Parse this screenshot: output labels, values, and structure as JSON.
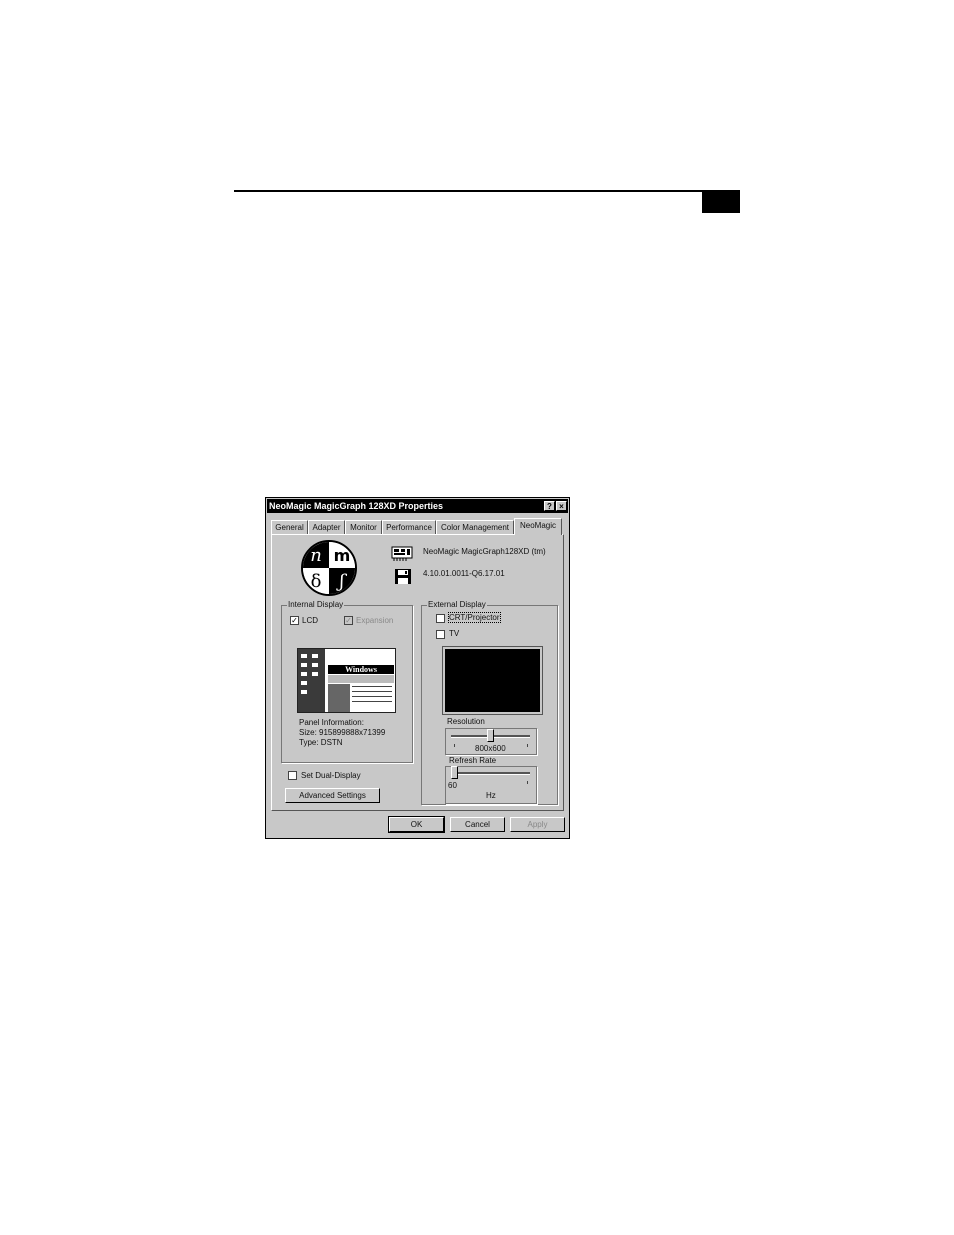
{
  "dialog": {
    "title": "NeoMagic MagicGraph 128XD Properties",
    "help_label": "?",
    "close_label": "×"
  },
  "tabs": [
    {
      "label": "General"
    },
    {
      "label": "Adapter"
    },
    {
      "label": "Monitor"
    },
    {
      "label": "Performance"
    },
    {
      "label": "Color Management"
    },
    {
      "label": "NeoMagic",
      "active": true
    }
  ],
  "logo": {
    "tl": "n",
    "tr": "m",
    "bl": "δ",
    "br": "ʃ"
  },
  "adapter": {
    "name": "NeoMagic MagicGraph128XD (tm)",
    "version": "4.10.01.0011-Q6.17.01"
  },
  "internal_display": {
    "label": "Internal Display",
    "lcd": {
      "label": "LCD",
      "checked": true
    },
    "expansion": {
      "label": "Expansion",
      "checked": true,
      "disabled": true
    },
    "preview_title": "Windows",
    "panel_info_label": "Panel Information:",
    "size": "Size: 915899888x71399",
    "type": "Type: DSTN"
  },
  "external_display": {
    "label": "External Display",
    "crt": {
      "label": "CRT/Projector",
      "checked": false
    },
    "tv": {
      "label": "TV",
      "checked": false
    },
    "resolution": {
      "label": "Resolution",
      "value": "800x600",
      "position": 0.5
    },
    "refresh": {
      "label": "Refresh Rate",
      "value": "60",
      "unit": "Hz",
      "position": 0.0
    }
  },
  "dual_display": {
    "label": "Set Dual-Display",
    "checked": false
  },
  "buttons": {
    "advanced": "Advanced Settings",
    "ok": "OK",
    "cancel": "Cancel",
    "apply": "Apply"
  }
}
